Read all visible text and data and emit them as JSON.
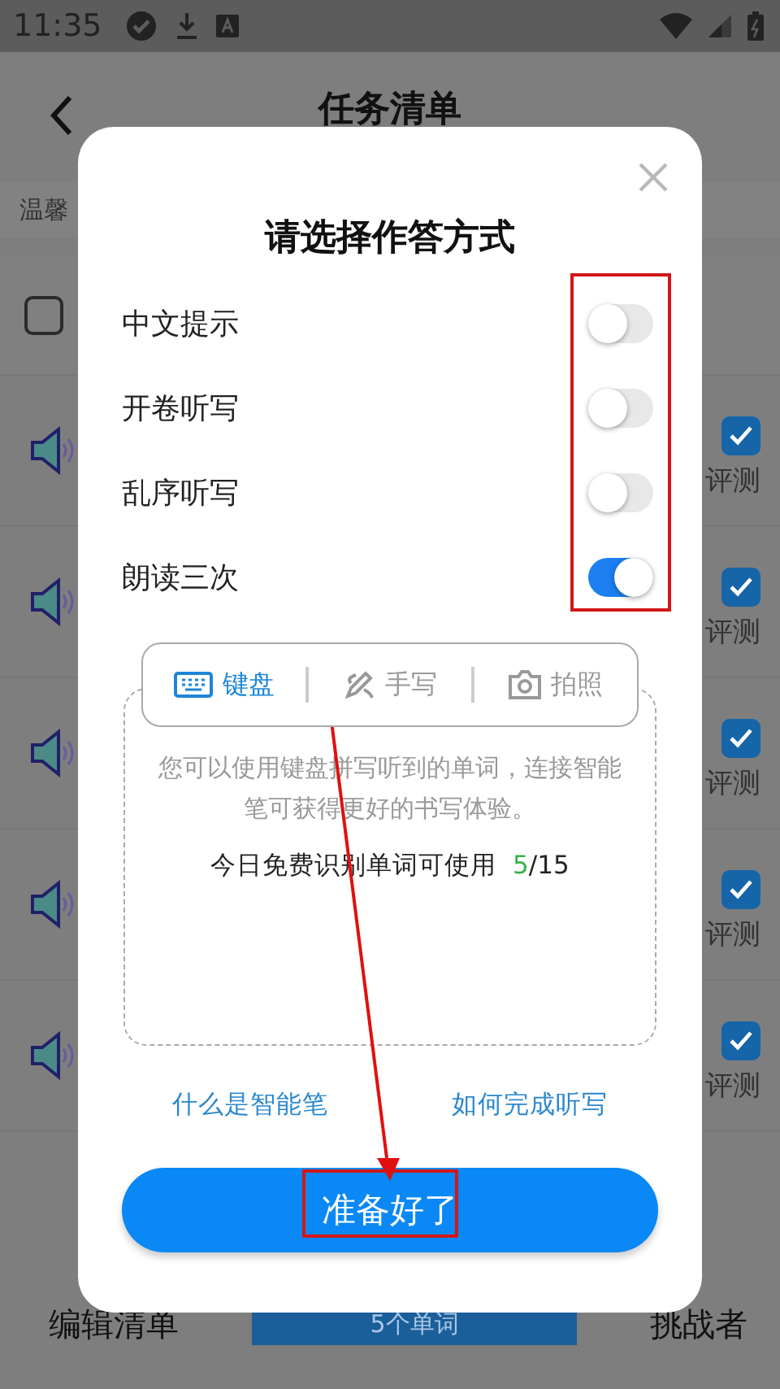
{
  "status_bar": {
    "time": "11:35"
  },
  "header": {
    "title": "任务清单"
  },
  "notice": "温馨",
  "select_all": {
    "checked": false
  },
  "words": [
    {
      "checked": true,
      "action": "评测"
    },
    {
      "checked": true,
      "action": "评测"
    },
    {
      "checked": true,
      "action": "评测"
    },
    {
      "checked": true,
      "action": "评测"
    },
    {
      "checked": true,
      "action": "评测"
    }
  ],
  "bottom_bar": {
    "edit": "编辑清单",
    "count_button": "5个单词",
    "challenger": "挑战者"
  },
  "dialog": {
    "title": "请选择作答方式",
    "options": [
      {
        "label": "中文提示",
        "on": false
      },
      {
        "label": "开卷听写",
        "on": false
      },
      {
        "label": "乱序听写",
        "on": false
      },
      {
        "label": "朗读三次",
        "on": true
      }
    ],
    "modes": [
      {
        "label": "键盘",
        "kind": "keyboard",
        "selected": true
      },
      {
        "label": "手写",
        "kind": "pen",
        "selected": false
      },
      {
        "label": "拍照",
        "kind": "camera",
        "selected": false
      }
    ],
    "description": "您可以使用键盘拼写听到的单词，连接智能笔可获得更好的书写体验。",
    "quota": {
      "label": "今日免费识别单词可使用",
      "used": "5",
      "total": "/15"
    },
    "links": [
      "什么是智能笔",
      "如何完成听写"
    ],
    "confirm": "准备好了"
  }
}
